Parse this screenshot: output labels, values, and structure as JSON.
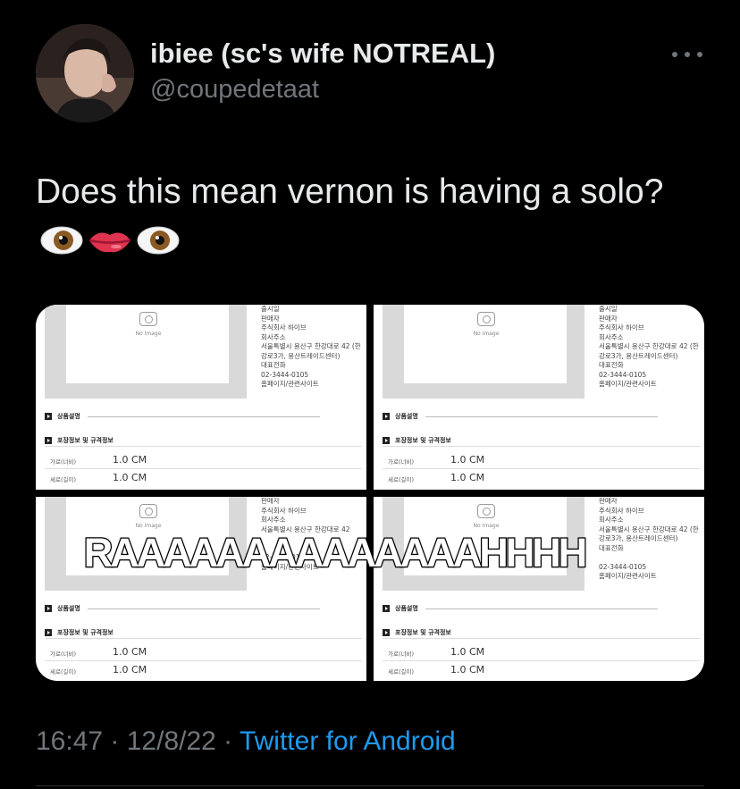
{
  "author": {
    "display_name": "ibiee (sc's wife NOTREAL)",
    "handle": "@coupedetaat",
    "avatar_icon": "profile-photo"
  },
  "more_icon": "more-horizontal-icon",
  "tweet": {
    "text": "Does this mean vernon is having a solo?",
    "emojis": [
      "eye-emoji",
      "lips-emoji",
      "eye-emoji"
    ]
  },
  "media": {
    "overlay_text": "RAAAAAAAAAAAAAAHHHH",
    "panels": [
      {
        "no_image_label": "No Image",
        "info_lines": [
          "출시일",
          "판매자",
          "주식회사 하이브",
          "회사주소",
          "서울특별시 용산구 한강대로 42 (한강로3가, 용산트레이드센터)",
          "대표전화",
          "02-3444-0105",
          "홈페이지/관련사이트"
        ],
        "section_desc": "상품설명",
        "section_pack": "포장정보 및 규격정보",
        "width_label": "가로(너비)",
        "width_value": "1.0 CM",
        "length_label": "세로(길이)",
        "length_value": "1.0 CM"
      },
      {
        "no_image_label": "No Image",
        "info_lines": [
          "출시일",
          "판매자",
          "주식회사 하이브",
          "회사주소",
          "서울특별시 용산구 한강대로 42 (한강로3가, 용산트레이드센터)",
          "대표전화",
          "02-3444-0105",
          "홈페이지/관련사이트"
        ],
        "section_desc": "상품설명",
        "section_pack": "포장정보 및 규격정보",
        "width_label": "가로(너비)",
        "width_value": "1.0 CM",
        "length_label": "세로(길이)",
        "length_value": "1.0 CM"
      },
      {
        "no_image_label": "No Image",
        "info_lines": [
          "판매자",
          "주식회사 하이브",
          "회사주소",
          "서울특별시 용산구 한강대로 42",
          "",
          "",
          "02-3444-0105",
          "홈페이지/관련사이트"
        ],
        "section_desc": "상품설명",
        "section_pack": "포장정보 및 규격정보",
        "width_label": "가로(너비)",
        "width_value": "1.0 CM",
        "length_label": "세로(길이)",
        "length_value": "1.0 CM"
      },
      {
        "no_image_label": "No Image",
        "info_lines": [
          "판매자",
          "주식회사 하이브",
          "회사주소",
          "서울특별시 용산구 한강대로 42 (한강로3가, 용산트레이드센터)",
          "대표전화",
          "",
          "02-3444-0105",
          "홈페이지/관련사이트"
        ],
        "section_desc": "상품설명",
        "section_pack": "포장정보 및 규격정보",
        "width_label": "가로(너비)",
        "width_value": "1.0 CM",
        "length_label": "세로(길이)",
        "length_value": "1.0 CM"
      }
    ]
  },
  "meta": {
    "time": "16:47",
    "separator": " · ",
    "date": "12/8/22",
    "source": "Twitter for Android"
  },
  "colors": {
    "background": "#000000",
    "text": "#e7e9ea",
    "muted": "#71767b",
    "link": "#1d9bf0"
  }
}
